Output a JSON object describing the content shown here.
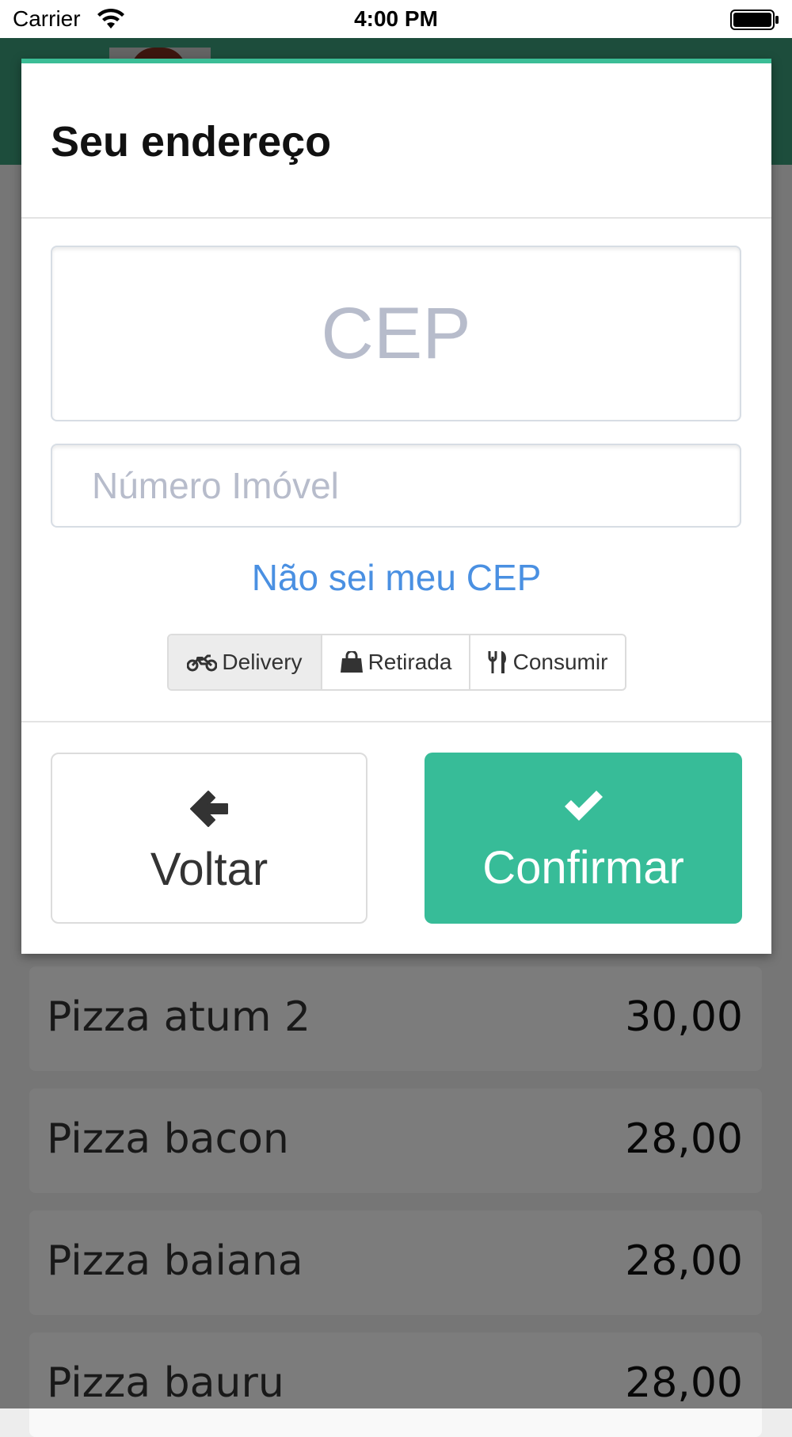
{
  "status_bar": {
    "carrier": "Carrier",
    "time": "4:00 PM"
  },
  "menu": {
    "items": [
      {
        "name": "Pizza atum 2",
        "price": "30,00"
      },
      {
        "name": "Pizza bacon",
        "price": "28,00"
      },
      {
        "name": "Pizza baiana",
        "price": "28,00"
      },
      {
        "name": "Pizza bauru",
        "price": "28,00"
      }
    ]
  },
  "modal": {
    "title": "Seu endereço",
    "cep_placeholder": "CEP",
    "number_placeholder": "Número Imóvel",
    "cep_link": "Não sei meu CEP",
    "order_types": [
      {
        "label": "Delivery",
        "icon": "motorcycle-icon",
        "selected": true
      },
      {
        "label": "Retirada",
        "icon": "shopping-bag-icon",
        "selected": false
      },
      {
        "label": "Consumir",
        "icon": "utensils-icon",
        "selected": false
      }
    ],
    "back_label": "Voltar",
    "confirm_label": "Confirmar"
  },
  "colors": {
    "header_green": "#3a9b78",
    "accent_green": "#37bc98",
    "link_blue": "#4a90e2",
    "placeholder_gray": "#b7bccb"
  }
}
